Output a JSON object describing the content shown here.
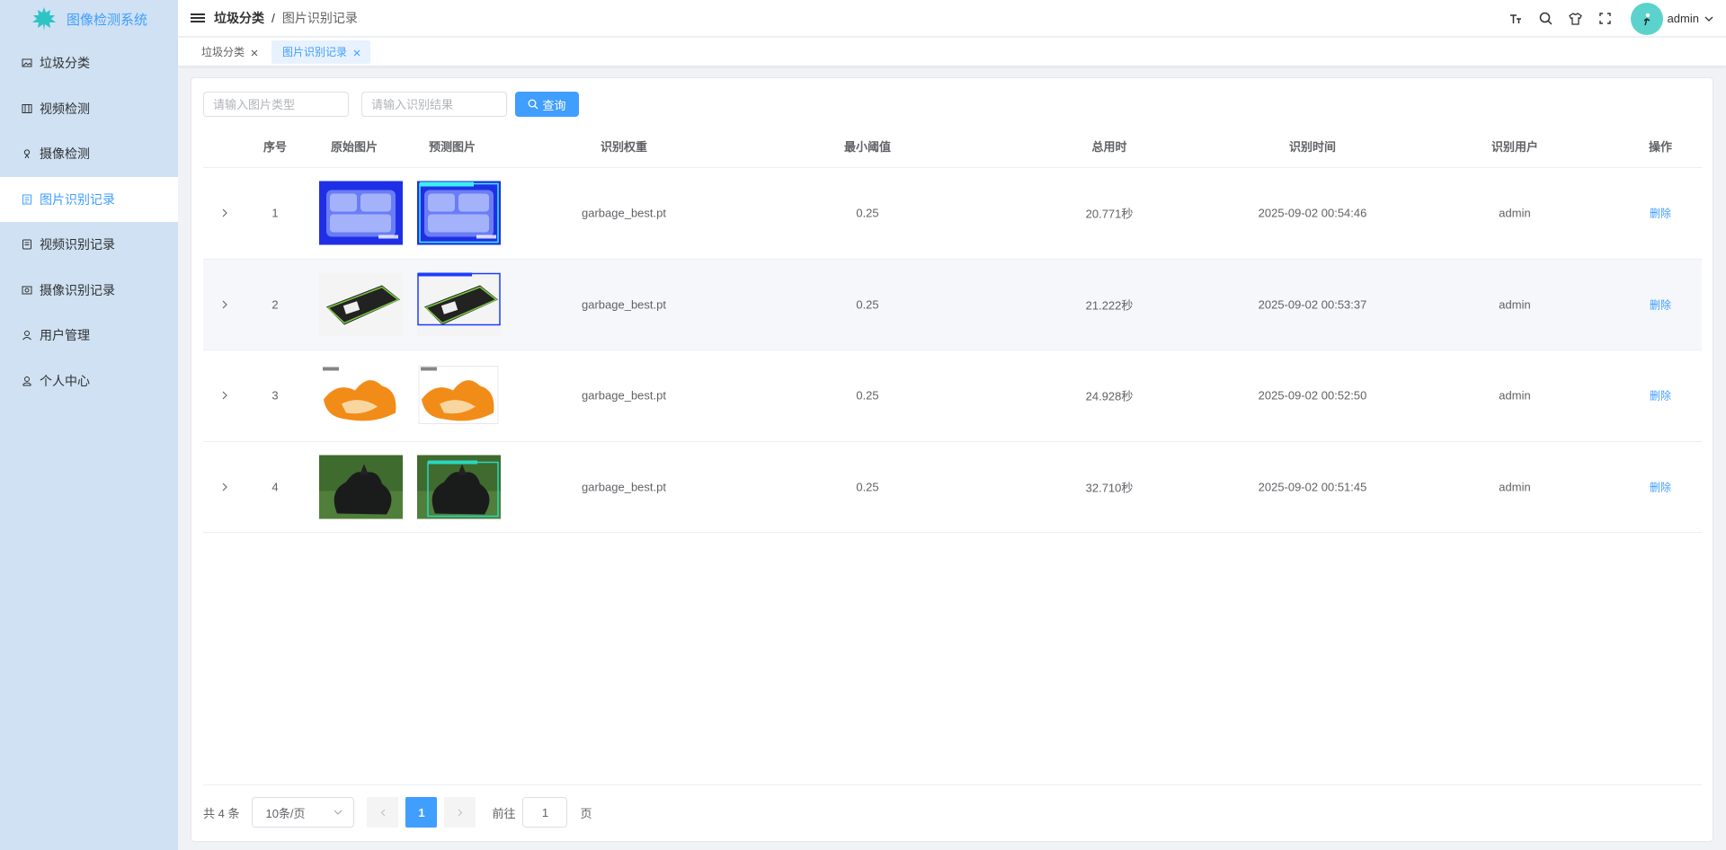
{
  "app": {
    "title": "图像检测系统"
  },
  "sidebar": {
    "items": [
      {
        "label": "垃圾分类",
        "icon": "image-icon",
        "active": false
      },
      {
        "label": "视频检测",
        "icon": "video-icon",
        "active": false
      },
      {
        "label": "摄像检测",
        "icon": "camera-icon",
        "active": false
      },
      {
        "label": "图片识别记录",
        "icon": "record-icon",
        "active": true
      },
      {
        "label": "视频识别记录",
        "icon": "video-record-icon",
        "active": false
      },
      {
        "label": "摄像识别记录",
        "icon": "camera-record-icon",
        "active": false
      },
      {
        "label": "用户管理",
        "icon": "user-icon",
        "active": false
      },
      {
        "label": "个人中心",
        "icon": "person-icon",
        "active": false
      }
    ]
  },
  "navbar": {
    "breadcrumb": [
      "垃圾分类",
      "图片识别记录"
    ],
    "breadcrumb_sep": "/",
    "user": "admin"
  },
  "tags": [
    {
      "label": "垃圾分类",
      "active": false
    },
    {
      "label": "图片识别记录",
      "active": true
    }
  ],
  "filters": {
    "type_placeholder": "请输入图片类型",
    "result_placeholder": "请输入识别结果",
    "query_label": "查询"
  },
  "table": {
    "headers": {
      "index": "序号",
      "original": "原始图片",
      "predicted": "预测图片",
      "weight": "识别权重",
      "threshold": "最小阈值",
      "duration": "总用时",
      "time": "识别时间",
      "user": "识别用户",
      "action": "操作"
    },
    "rows": [
      {
        "index": "1",
        "image_kind": "food-container",
        "weight": "garbage_best.pt",
        "threshold": "0.25",
        "duration": "20.771秒",
        "time": "2025-09-02 00:54:46",
        "user": "admin",
        "action": "删除"
      },
      {
        "index": "2",
        "image_kind": "power-bank",
        "weight": "garbage_best.pt",
        "threshold": "0.25",
        "duration": "21.222秒",
        "time": "2025-09-02 00:53:37",
        "user": "admin",
        "action": "删除"
      },
      {
        "index": "3",
        "image_kind": "orange-peel",
        "weight": "garbage_best.pt",
        "threshold": "0.25",
        "duration": "24.928秒",
        "time": "2025-09-02 00:52:50",
        "user": "admin",
        "action": "删除"
      },
      {
        "index": "4",
        "image_kind": "garbage-bag",
        "weight": "garbage_best.pt",
        "threshold": "0.25",
        "duration": "32.710秒",
        "time": "2025-09-02 00:51:45",
        "user": "admin",
        "action": "删除"
      }
    ]
  },
  "pagination": {
    "total": "共 4 条",
    "page_size": "10条/页",
    "current_page": "1",
    "goto_label": "前往",
    "goto_value": "1",
    "page_suffix": "页"
  },
  "colors": {
    "accent": "#409eff",
    "sidebar_bg": "#cfe1f2",
    "avatar": "#5bd3cc"
  }
}
